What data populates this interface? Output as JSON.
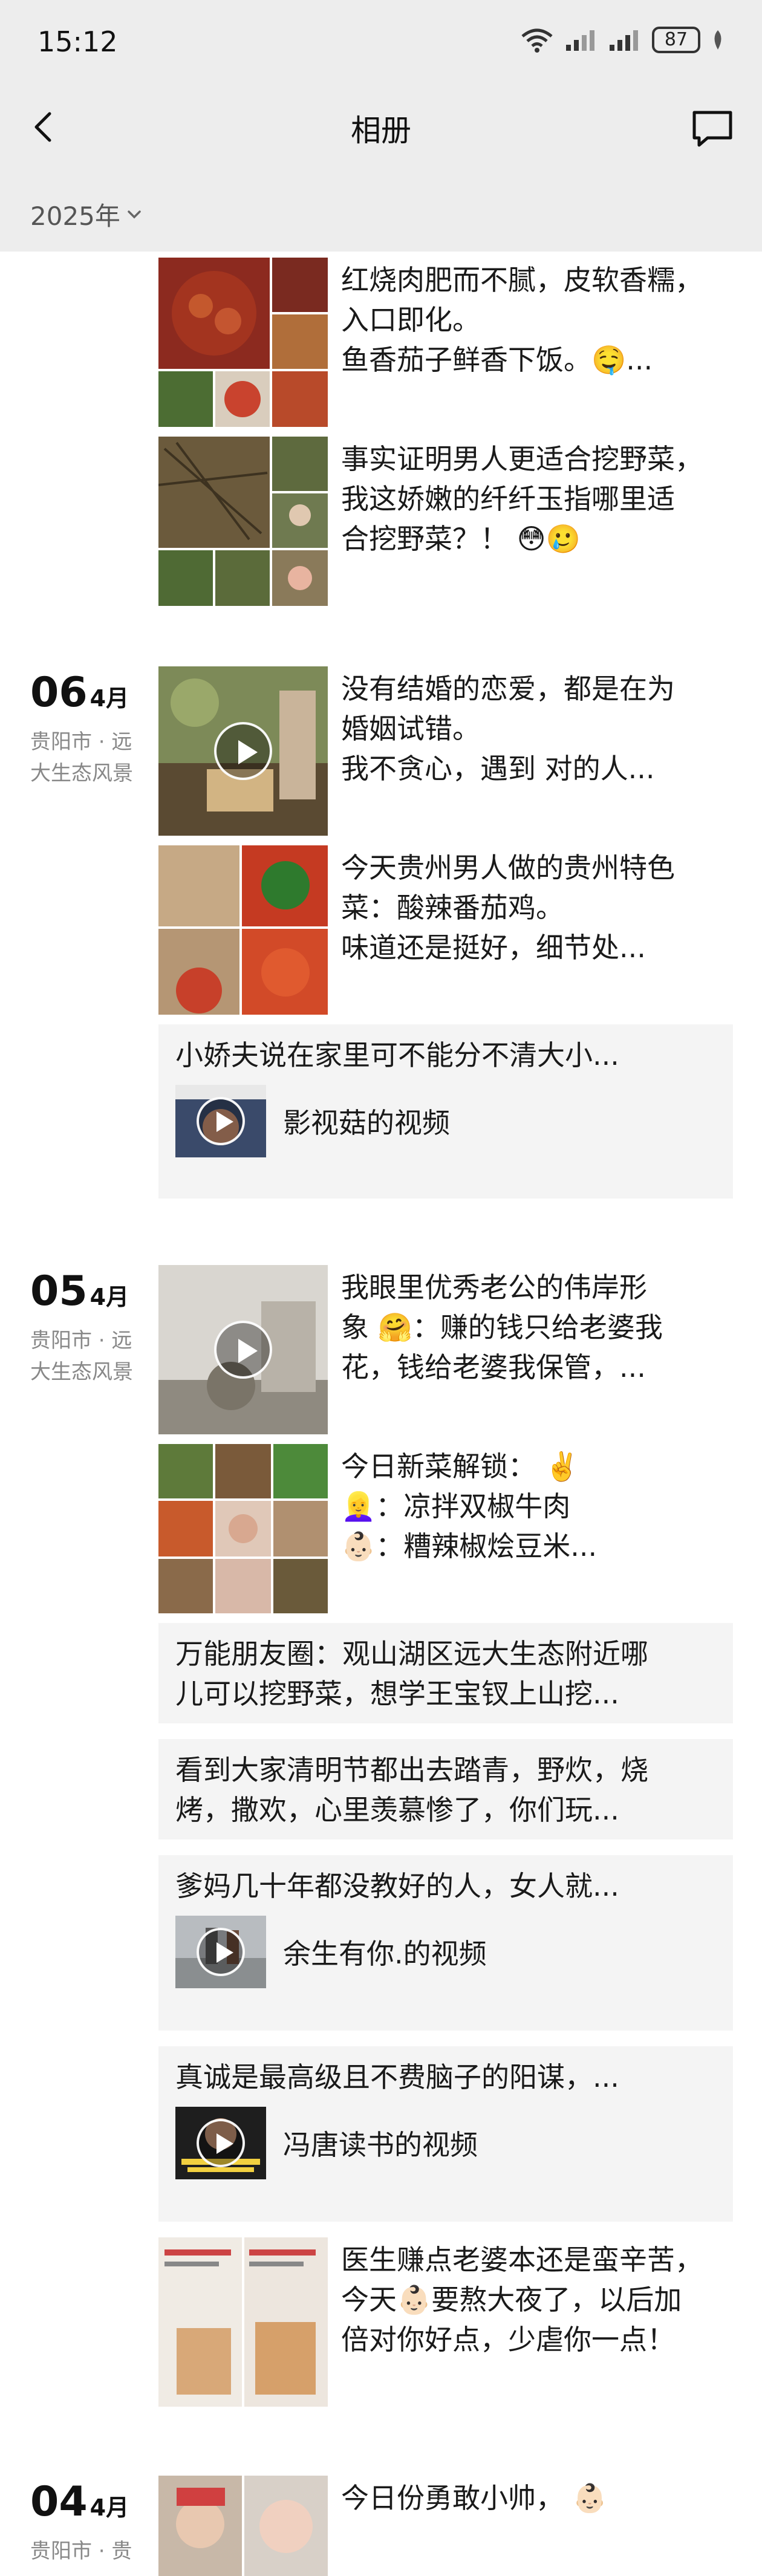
{
  "status_bar": {
    "time": "15:12",
    "battery": "87"
  },
  "nav": {
    "title": "相册"
  },
  "year_filter": {
    "label": "2025年"
  },
  "groups": [
    {
      "posts": [
        {
          "lines": [
            "红烧肉肥而不腻，皮软香糯，",
            "入口即化。",
            "鱼香茄子鲜香下饭。🤤..."
          ]
        },
        {
          "lines": [
            "事实证明男人更适合挖野菜，",
            "我这娇嫩的纤纤玉指哪里适",
            "合挖野菜？！ 😳🥲"
          ]
        }
      ]
    },
    {
      "day": "06",
      "month": "4月",
      "location": "贵阳市 · 远大生态风景",
      "posts": [
        {
          "lines": [
            "没有结婚的恋爱，都是在为",
            "婚姻试错。",
            "我不贪心，遇到 对的人..."
          ]
        },
        {
          "lines": [
            "今天贵州男人做的贵州特色",
            "菜：酸辣番茄鸡。",
            "味道还是挺好，细节处..."
          ]
        },
        {
          "text": "小娇夫说在家里可不能分不清大小...",
          "video_label": "影视菇的视频"
        }
      ]
    },
    {
      "day": "05",
      "month": "4月",
      "location": "贵阳市 · 远大生态风景",
      "posts": [
        {
          "lines": [
            "我眼里优秀老公的伟岸形",
            "象 🤗：赚的钱只给老婆我",
            "花，钱给老婆我保管，..."
          ]
        },
        {
          "lines": [
            "今日新菜解锁： ✌️",
            "👱‍♀️：凉拌双椒牛肉",
            "👶🏻：糟辣椒烩豆米..."
          ]
        },
        {
          "text_lines": [
            "万能朋友圈：观山湖区远大生态附近哪",
            "儿可以挖野菜，想学王宝钗上山挖..."
          ]
        },
        {
          "text_lines": [
            "看到大家清明节都出去踏青，野炊，烧",
            "烤，撒欢，心里羡慕惨了，你们玩..."
          ]
        },
        {
          "text": "爹妈几十年都没教好的人，女人就...",
          "video_label": "余生有你.的视频"
        },
        {
          "text": "真诚是最高级且不费脑子的阳谋，...",
          "video_label": "冯唐读书的视频"
        },
        {
          "lines": [
            "医生赚点老婆本还是蛮辛苦，",
            "今天👶🏻要熬大夜了，以后加",
            "倍对你好点，少虐你一点！"
          ]
        }
      ]
    },
    {
      "day": "04",
      "month": "4月",
      "location": "贵阳市 · 贵",
      "posts": [
        {
          "lines": [
            "今日份勇敢小帅， 👶🏻"
          ]
        }
      ]
    }
  ],
  "colors": {
    "header_bg": "#ededed",
    "card_bg": "#f4f4f4",
    "meta_text": "#888888"
  }
}
